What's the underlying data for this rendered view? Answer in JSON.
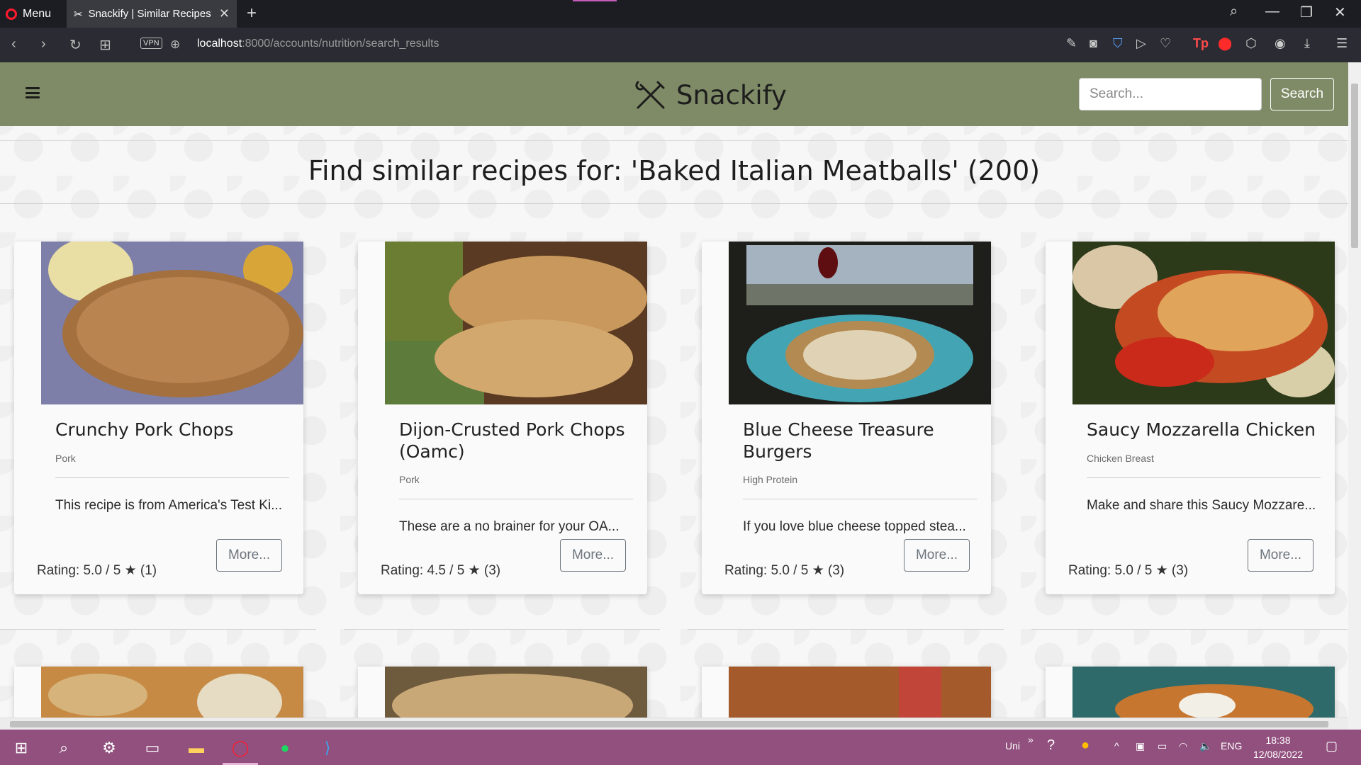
{
  "browser": {
    "menu_label": "Menu",
    "tab_title": "Snackify | Similar Recipes",
    "tab_close": "✕",
    "new_tab": "+",
    "vpn_label": "VPN",
    "url_host": "localhost",
    "url_rest": ":8000/accounts/nutrition/search_results"
  },
  "navbar": {
    "brand": "Snackify",
    "search_placeholder": "Search...",
    "search_button": "Search",
    "color": "#7f8b66"
  },
  "page_title": "Find similar recipes for: 'Baked Italian Meatballs' (200)",
  "recipes": [
    {
      "name": "Crunchy Pork Chops",
      "category": "Pork",
      "description": "This recipe is from America's Test Ki...",
      "rating": "Rating: 5.0 / 5",
      "count": "(1)",
      "more": "More..."
    },
    {
      "name": "Dijon-Crusted Pork Chops (Oamc)",
      "category": "Pork",
      "description": "These are a no brainer for your OA...",
      "rating": "Rating: 4.5 / 5",
      "count": "(3)",
      "more": "More..."
    },
    {
      "name": "Blue Cheese Treasure Burgers",
      "category": "High Protein",
      "description": "If you love blue cheese topped stea...",
      "rating": "Rating: 5.0 / 5",
      "count": "(3)",
      "more": "More..."
    },
    {
      "name": "Saucy Mozzarella Chicken",
      "category": "Chicken Breast",
      "description": "Make and share this Saucy Mozzare...",
      "rating": "Rating: 5.0 / 5",
      "count": "(3)",
      "more": "More..."
    }
  ],
  "taskbar": {
    "lang_short": "Uni",
    "lang": "ENG",
    "time": "18:38",
    "date": "12/08/2022"
  }
}
